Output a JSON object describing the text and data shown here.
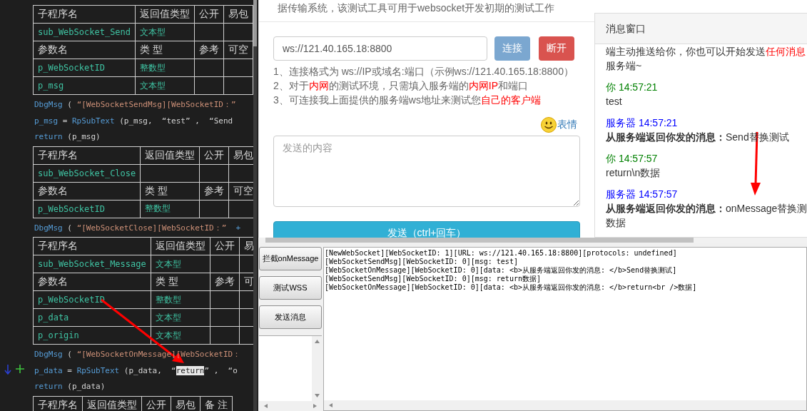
{
  "code_editor": {
    "blocks": [
      {
        "kind": "table",
        "rows": [
          {
            "kind": "header",
            "cells": [
              "子程序名",
              "返回值类型",
              "公开",
              "易包"
            ]
          },
          {
            "kind": "value",
            "cells": [
              "sub_WebSocket_Send",
              "文本型",
              null,
              null
            ]
          },
          {
            "kind": "header",
            "cells": [
              "参数名",
              "类 型",
              "参考",
              "可空"
            ]
          },
          {
            "kind": "value",
            "cells": [
              "p_WebSocketID",
              "整数型",
              null,
              null
            ]
          },
          {
            "kind": "value",
            "cells": [
              "p_msg",
              "文本型",
              null,
              null
            ]
          }
        ]
      },
      {
        "kind": "code",
        "lines": [
          {
            "marked": false,
            "tokens": [
              {
                "kind": "ident",
                "text": "DbgMsg"
              },
              {
                "kind": "punct",
                "text": " ( "
              },
              {
                "kind": "string",
                "text": "“[WebSocketSendMsg][WebSocketID：”"
              }
            ]
          },
          {
            "marked": false,
            "tokens": [
              {
                "kind": "ident",
                "text": "p_msg"
              },
              {
                "kind": "punct",
                "text": " = "
              },
              {
                "kind": "ident",
                "text": "RpSubText"
              },
              {
                "kind": "punct",
                "text": " (p_msg,  “test” ,  “Send"
              }
            ]
          },
          {
            "marked": false,
            "tokens": [
              {
                "kind": "ident",
                "text": "return"
              },
              {
                "kind": "punct",
                "text": " (p_msg)"
              }
            ]
          }
        ]
      },
      {
        "kind": "table",
        "rows": [
          {
            "kind": "header",
            "cells": [
              "子程序名",
              "返回值类型",
              "公开",
              "易包"
            ]
          },
          {
            "kind": "value",
            "cells": [
              "sub_WebSocket_Close",
              null,
              null,
              null
            ]
          },
          {
            "kind": "header",
            "cells": [
              "参数名",
              "类 型",
              "参考",
              "可空"
            ]
          },
          {
            "kind": "value",
            "cells": [
              "p_WebSocketID",
              "整数型",
              null,
              null
            ]
          }
        ]
      },
      {
        "kind": "code",
        "lines": [
          {
            "marked": false,
            "tokens": [
              {
                "kind": "ident",
                "text": "DbgMsg"
              },
              {
                "kind": "punct",
                "text": " ( "
              },
              {
                "kind": "string",
                "text": "“[WebSocketClose][WebSocketID：”"
              },
              {
                "kind": "ident",
                "text": "  +"
              }
            ]
          }
        ]
      },
      {
        "kind": "table",
        "rows": [
          {
            "kind": "header",
            "cells": [
              "子程序名",
              "返回值类型",
              "公开",
              "易"
            ]
          },
          {
            "kind": "value",
            "cells": [
              "sub_WebSocket_Message",
              "文本型",
              null,
              null
            ]
          },
          {
            "kind": "header",
            "cells": [
              "参数名",
              "类 型",
              "参考",
              "可"
            ]
          },
          {
            "kind": "value",
            "cells": [
              "p_WebSocketID",
              "整数型",
              null,
              null
            ]
          },
          {
            "kind": "value",
            "cells": [
              "p_data",
              "文本型",
              null,
              null
            ]
          },
          {
            "kind": "value",
            "cells": [
              "p_origin",
              "文本型",
              null,
              null
            ]
          }
        ]
      },
      {
        "kind": "code",
        "lines": [
          {
            "marked": false,
            "tokens": [
              {
                "kind": "ident",
                "text": "DbgMsg"
              },
              {
                "kind": "punct",
                "text": " ( "
              },
              {
                "kind": "string",
                "text": "“[WebSocketOnMessage][WebSocketID："
              }
            ]
          },
          {
            "marked": true,
            "tokens": [
              {
                "kind": "ident",
                "text": "p_data"
              },
              {
                "kind": "punct",
                "text": " = "
              },
              {
                "kind": "ident",
                "text": "RpSubText"
              },
              {
                "kind": "punct",
                "text": " (p_data,  “"
              },
              {
                "kind": "highlight",
                "text": "return"
              },
              {
                "kind": "punct",
                "text": "” ,  “o"
              }
            ]
          },
          {
            "marked": false,
            "tokens": [
              {
                "kind": "ident",
                "text": "return"
              },
              {
                "kind": "punct",
                "text": " (p_data)"
              }
            ]
          }
        ]
      },
      {
        "kind": "table",
        "rows": [
          {
            "kind": "header",
            "cells": [
              "子程序名",
              "返回值类型",
              "公开",
              "易包",
              "备 注"
            ]
          }
        ]
      }
    ]
  },
  "web_page": {
    "intro": "据传输系统，该测试工具可用于websocket开发初期的测试工作",
    "url_field": {
      "value": "ws://121.40.165.18:8800"
    },
    "buttons": [
      {
        "kind": "connect",
        "label": "连接"
      },
      {
        "kind": "disconnect",
        "label": "断开"
      }
    ],
    "help_lines": [
      [
        {
          "text": "1、连接格式为 ws://IP或域名:端口（示例ws://121.40.165.18:8800）",
          "red": false
        }
      ],
      [
        {
          "text": "2、对于",
          "red": false
        },
        {
          "text": "内网",
          "red": true
        },
        {
          "text": "的测试环境，只需填入服务端的",
          "red": false
        },
        {
          "text": "内网IP",
          "red": true
        },
        {
          "text": "和端口",
          "red": false
        }
      ],
      [
        {
          "text": "3、可连接我上面提供的服务端ws地址来测试您",
          "red": false
        },
        {
          "text": "自己的客户端",
          "red": true
        }
      ]
    ],
    "emoji_link": "表情",
    "message_field": {
      "placeholder": "发送的内容"
    },
    "send_button": "发送（ctrl+回车）",
    "message_panel": {
      "title": "消息窗口",
      "notice": [
        [
          {
            "text": "端主动推送给你，你也可以开始发送",
            "red": false
          },
          {
            "text": "任何消息",
            "red": true
          }
        ],
        [
          {
            "text": "服务端~",
            "red": false
          }
        ]
      ],
      "messages": [
        {
          "kind": "you",
          "meta": "你 14:57:21",
          "lines": [
            "test"
          ]
        },
        {
          "kind": "server",
          "meta": "服务器 14:57:21",
          "lines": [
            "**从服务端返回你发的消息：**Send替换测试"
          ]
        },
        {
          "kind": "you",
          "meta": "你 14:57:57",
          "lines": [
            "return\\n数据"
          ]
        },
        {
          "kind": "server",
          "meta": "服务器 14:57:57",
          "lines": [
            "**从服务端返回你发的消息：**onMessage替换测",
            "数据"
          ]
        }
      ]
    }
  },
  "tool_form": {
    "buttons": [
      "拦截onMessage",
      "测试WSS",
      "发送消息"
    ],
    "log": [
      "[NewWebSocket][WebSocketID: 1][URL: ws://121.40.165.18:8800][protocols: undefined]",
      "[WebSocketSendMsg][WebSocketID: 0][msg: test]",
      "[WebSocketOnMessage][WebSocketID: 0][data: <b>从服务端返回你发的消息: </b>Send替换测试]",
      "[WebSocketSendMsg][WebSocketID: 0][msg: return数据]",
      "[WebSocketOnMessage][WebSocketID: 0][data: <b>从服务端返回你发的消息: </b>return<br />数据]"
    ]
  }
}
